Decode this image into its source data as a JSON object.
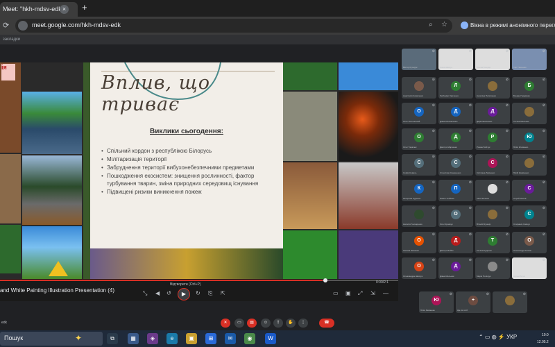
{
  "browser": {
    "tab_title": "Meet: \"hkh-mdsv-edk\"",
    "close_glyph": "×",
    "new_tab_glyph": "+",
    "url": "meet.google.com/hkh-mdsv-edk",
    "incognito_label": "Вікна в режимі анонімного перегляд",
    "bookmarks_text": "закладки"
  },
  "slide": {
    "title": "Вплив, що триває",
    "heading": "Виклики сьогодення:",
    "bullets": [
      "Спільний кордон з республікою Білорусь",
      "Мілітаризація території",
      "Забруднення території вибухонебезпечними предметами",
      "Пошкодження екосистем: знищення рослинності, фактор турбування тварин, зміна природних середовищ існування",
      "Підвищені ризики виникнення пожеж"
    ],
    "badge": "ія"
  },
  "controls": {
    "presentation_title": "and White Painting Illustration Presentation (4)",
    "time_center": "Відтворити (Ctrl+P)",
    "time_right": "0:00/2:1",
    "progress": 0.81
  },
  "participants": [
    {
      "name": "Віктор Кучерук",
      "initial": "",
      "color": "#5a6b7a",
      "video": true
    },
    {
      "name": "Анна Шевчук",
      "initial": "",
      "color": "#ddd",
      "video": true
    },
    {
      "name": "Олена Бондар",
      "initial": "",
      "color": "#ddd",
      "video": true
    },
    {
      "name": "Ігор Ткаченко",
      "initial": "",
      "color": "#7a8fb0",
      "video": true
    },
    {
      "name": "Андрій Панченко",
      "initial": "",
      "color": "#888",
      "video": true
    },
    {
      "name": "Анастасія Коваленко",
      "initial": "",
      "color": "#7a5a4a",
      "video": false
    },
    {
      "name": "Любомир Харченко",
      "initial": "Л",
      "color": "#2e7d32",
      "video": false
    },
    {
      "name": "Ангеліна Пилипенко",
      "initial": "",
      "color": "#8a6d3b",
      "video": false
    },
    {
      "name": "Богдан Гордієнко",
      "initial": "Б",
      "color": "#2e7d32",
      "video": false
    },
    {
      "name": "",
      "initial": "Б",
      "color": "#2e7d32",
      "video": false
    },
    {
      "name": "Олег Полонський",
      "initial": "О",
      "color": "#1565c0",
      "video": false
    },
    {
      "name": "Діана Москаленко",
      "initial": "Д",
      "color": "#1565c0",
      "video": false
    },
    {
      "name": "Дарія Шевченко",
      "initial": "Д",
      "color": "#6a1b9a",
      "video": false
    },
    {
      "name": "Тетяна Мельник",
      "initial": "",
      "color": "#8a6d3b",
      "video": false
    },
    {
      "name": "",
      "initial": "",
      "color": "#8a6d3b",
      "video": false
    },
    {
      "name": "Олег Тарасюк",
      "initial": "О",
      "color": "#2e7d32",
      "video": false
    },
    {
      "name": "Дмитро Марченко",
      "initial": "Д",
      "color": "#2e7d32",
      "video": false
    },
    {
      "name": "Роман Бойчук",
      "initial": "Р",
      "color": "#2e7d32",
      "video": false
    },
    {
      "name": "Юлія Клименко",
      "initial": "Ю",
      "color": "#00838f",
      "video": false
    },
    {
      "name": "",
      "initial": "Д",
      "color": "#00838f",
      "video": false
    },
    {
      "name": "Софія Коваль",
      "initial": "С",
      "color": "#546e7a",
      "video": false
    },
    {
      "name": "Станіслав Семененко",
      "initial": "С",
      "color": "#546e7a",
      "video": false
    },
    {
      "name": "Світлана Левченко",
      "initial": "С",
      "color": "#ad1457",
      "video": false
    },
    {
      "name": "Юрій Кравченко",
      "initial": "",
      "color": "#8a6d3b",
      "video": false
    },
    {
      "name": "",
      "initial": "",
      "color": "#8a6d3b",
      "video": false
    },
    {
      "name": "Катерина Руденко",
      "initial": "К",
      "color": "#1565c0",
      "video": false
    },
    {
      "name": "Павло Олійник",
      "initial": "П",
      "color": "#1565c0",
      "video": false
    },
    {
      "name": "Інна Лисенко",
      "initial": "",
      "color": "#ddd",
      "video": false
    },
    {
      "name": "Сергій Попов",
      "initial": "С",
      "color": "#6a1b9a",
      "video": false
    },
    {
      "name": "",
      "initial": "С",
      "color": "#6a1b9a",
      "video": false
    },
    {
      "name": "Наталія Гончаренко",
      "initial": "",
      "color": "#2e4a2e",
      "video": false
    },
    {
      "name": "Олег Кравчук",
      "initial": "О",
      "color": "#546e7a",
      "video": false
    },
    {
      "name": "Віталій Кушнір",
      "initial": "",
      "color": "#8a6d3b",
      "video": false
    },
    {
      "name": "Стефанія Савчук",
      "initial": "С",
      "color": "#00838f",
      "video": false
    },
    {
      "name": "",
      "initial": "С",
      "color": "#00838f",
      "video": false
    },
    {
      "name": "Оксана Іваненко",
      "initial": "О",
      "color": "#e65100",
      "video": false
    },
    {
      "name": "Дмитро Бойко",
      "initial": "Д",
      "color": "#b71c1c",
      "video": false
    },
    {
      "name": "Тетяна Руденко",
      "initial": "Т",
      "color": "#2e7d32",
      "video": false
    },
    {
      "name": "Олександр Литвин",
      "initial": "О",
      "color": "#7a5a4a",
      "video": false
    },
    {
      "name": "",
      "initial": "О",
      "color": "#7a5a4a",
      "video": false
    },
    {
      "name": "Олександра Шевчук",
      "initial": "О",
      "color": "#d84315",
      "video": false
    },
    {
      "name": "Діана Мельник",
      "initial": "Д",
      "color": "#6a1b9a",
      "video": false
    },
    {
      "name": "Марія Поліщук",
      "initial": "",
      "color": "#8a8a8a",
      "video": false
    },
    {
      "name": "Артем Білик",
      "initial": "",
      "color": "#ddd",
      "video": true
    },
    {
      "name": "Лілія Шевченко",
      "initial": "Л",
      "color": "#1565c0",
      "video": false
    },
    {
      "name": "Юлія Яковенко",
      "initial": "Ю",
      "color": "#ad1457",
      "video": false
    },
    {
      "name": "Ще 12 осіб",
      "initial": "+",
      "color": "#6d4c41",
      "video": false
    },
    {
      "name": "",
      "initial": "",
      "color": "#8a6d3b",
      "video": false
    }
  ],
  "call": {
    "meeting_code": "edk",
    "buttons": [
      "mic",
      "camera",
      "captions",
      "emoji",
      "present",
      "raise-hand",
      "more",
      "leave"
    ]
  },
  "taskbar": {
    "search_label": "Пошук",
    "lang": "УКР",
    "time": "10:0",
    "date": "12.05.2"
  }
}
